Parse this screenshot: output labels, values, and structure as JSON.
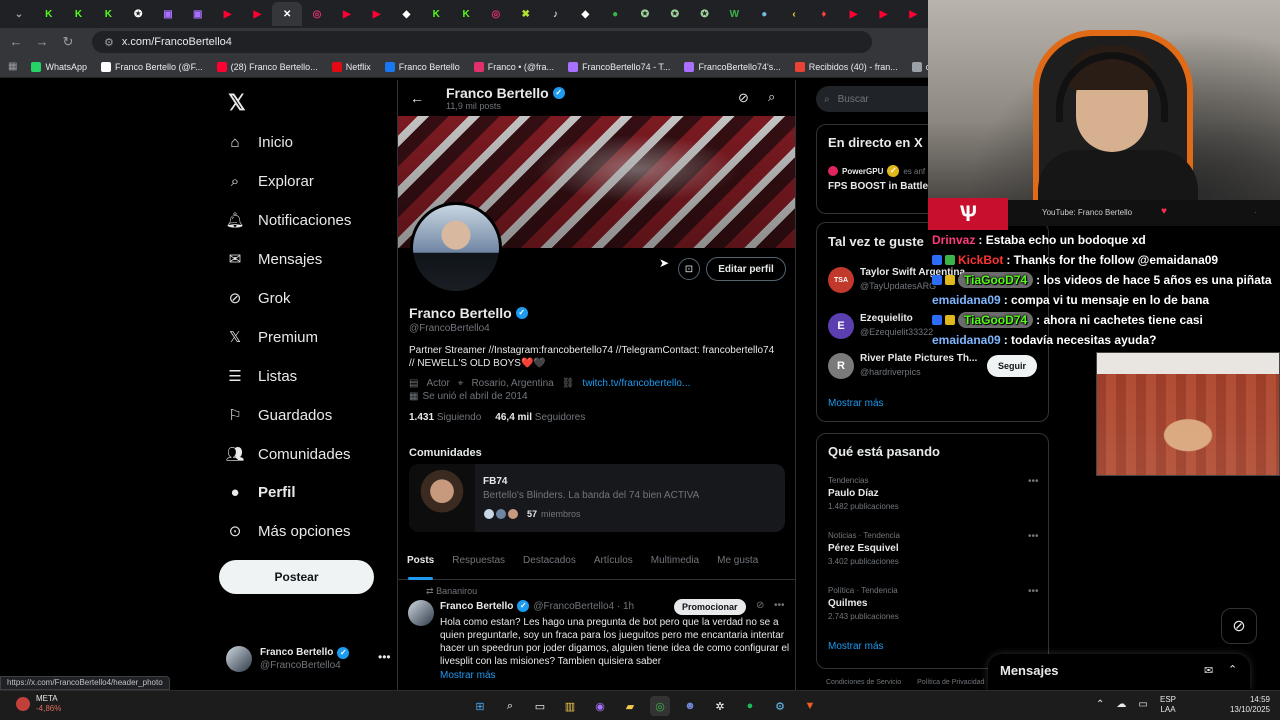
{
  "browser": {
    "url": "x.com/FrancoBertello4",
    "status_url": "https://x.com/FrancoBertello4/header_photo",
    "tabs": [
      {
        "glyph": "K",
        "color": "#53fc18"
      },
      {
        "glyph": "K",
        "color": "#53fc18"
      },
      {
        "glyph": "K",
        "color": "#53fc18"
      },
      {
        "glyph": "✪",
        "color": "#ffffff"
      },
      {
        "glyph": "▣",
        "color": "#a970ff"
      },
      {
        "glyph": "▣",
        "color": "#a970ff"
      },
      {
        "glyph": "▶",
        "color": "#ff0033"
      },
      {
        "glyph": "▶",
        "color": "#ff0033"
      },
      {
        "glyph": "✕",
        "color": "#ffffff",
        "active": true
      },
      {
        "glyph": "◎",
        "color": "#e1306c"
      },
      {
        "glyph": "▶",
        "color": "#ff0033"
      },
      {
        "glyph": "▶",
        "color": "#ff0033"
      },
      {
        "glyph": "◆",
        "color": "#ffffff"
      },
      {
        "glyph": "K",
        "color": "#53fc18"
      },
      {
        "glyph": "K",
        "color": "#53fc18"
      },
      {
        "glyph": "◎",
        "color": "#e1306c"
      },
      {
        "glyph": "✖",
        "color": "#b4e233"
      },
      {
        "glyph": "♪",
        "color": "#ffffff"
      },
      {
        "glyph": "◆",
        "color": "#ffffff"
      },
      {
        "glyph": "●",
        "color": "#3bb54a"
      },
      {
        "glyph": "✪",
        "color": "#9fd39c"
      },
      {
        "glyph": "✪",
        "color": "#9fd39c"
      },
      {
        "glyph": "✪",
        "color": "#9fd39c"
      },
      {
        "glyph": "W",
        "color": "#3bb54a"
      },
      {
        "glyph": "●",
        "color": "#74b9e0"
      },
      {
        "glyph": "‹",
        "color": "#f6d53a"
      },
      {
        "glyph": "♦",
        "color": "#ff3b3b"
      },
      {
        "glyph": "▶",
        "color": "#ff0033"
      },
      {
        "glyph": "▶",
        "color": "#ff0033"
      },
      {
        "glyph": "▶",
        "color": "#ff0033"
      }
    ],
    "bookmarks": [
      {
        "label": "WhatsApp",
        "color": "#25d366"
      },
      {
        "label": "Franco Bertello (@F...",
        "color": "#ffffff"
      },
      {
        "label": "(28) Franco Bertello...",
        "color": "#ff0033"
      },
      {
        "label": "Netflix",
        "color": "#e50914"
      },
      {
        "label": "Franco Bertello",
        "color": "#1877f2"
      },
      {
        "label": "Franco • (@fra...",
        "color": "#e1306c"
      },
      {
        "label": "FrancoBertello74 - T...",
        "color": "#a970ff"
      },
      {
        "label": "FrancoBertello74's...",
        "color": "#a970ff"
      },
      {
        "label": "Recibidos (40) - fran...",
        "color": "#ea4335"
      },
      {
        "label": "outlook",
        "color": "#9aa0a6"
      },
      {
        "label": "Aler",
        "color": "#3bb54a"
      }
    ]
  },
  "nav": {
    "items": [
      {
        "label": "Inicio",
        "icon": "home-icon"
      },
      {
        "label": "Explorar",
        "icon": "search-icon"
      },
      {
        "label": "Notificaciones",
        "icon": "bell-icon"
      },
      {
        "label": "Mensajes",
        "icon": "mail-icon"
      },
      {
        "label": "Grok",
        "icon": "grok-icon"
      },
      {
        "label": "Premium",
        "icon": "x-icon"
      },
      {
        "label": "Listas",
        "icon": "list-icon"
      },
      {
        "label": "Guardados",
        "icon": "bookmark-icon"
      },
      {
        "label": "Comunidades",
        "icon": "people-icon"
      },
      {
        "label": "Perfil",
        "icon": "person-icon"
      },
      {
        "label": "Más opciones",
        "icon": "more-circle-icon"
      }
    ],
    "post_button": "Postear",
    "account_name": "Franco Bertello",
    "account_handle": "@FrancoBertello4"
  },
  "profile": {
    "name": "Franco Bertello",
    "post_count": "11,9 mil posts",
    "handle": "@FrancoBertello4",
    "edit_button": "Editar perfil",
    "bio": "Partner Streamer //Instagram:francobertello74 //TelegramContact: francobertello74 // NEWELL'S OLD BOYS❤️🖤",
    "category": "Actor",
    "location": "Rosario, Argentina",
    "link": "twitch.tv/francobertello...",
    "joined": "Se unió el abril de 2014",
    "following_count": "1.431",
    "following_label": "Siguiendo",
    "followers_count": "46,4 mil",
    "followers_label": "Seguidores"
  },
  "community": {
    "title": "Comunidades",
    "name": "FB74",
    "description": "Bertello's Blinders. La banda del 74 bien ACTIVA",
    "members_count": "57",
    "members_label": "miembros"
  },
  "tabs": [
    "Posts",
    "Respuestas",
    "Destacados",
    "Artículos",
    "Multimedia",
    "Me gusta"
  ],
  "post": {
    "repost_label": "Bananirou",
    "author": "Franco Bertello",
    "handle_time": "@FrancoBertello4 · 1h",
    "promote_button": "Promocionar",
    "text": "Hola como estan? Les hago una pregunta de bot pero que la verdad no se a quien preguntarle, soy un fraca para los jueguitos pero me encantaria intentar hacer un speedrun por joder digamos, alguien tiene idea de como configurar el livesplit con las misiones? Tambien quisiera saber",
    "more_label": "Mostrar más"
  },
  "right": {
    "search_placeholder": "Buscar",
    "live_title": "En directo en X",
    "live_account": "PowerGPU",
    "live_suffix": "es anf",
    "live_stream_title": "FPS BOOST in Battle",
    "suggest_title": "Tal vez te guste",
    "suggestions": [
      {
        "name": "Taylor Swift Argentina",
        "handle": "@TayUpdatesARG",
        "initial": "TSA",
        "color": "#c0392b"
      },
      {
        "name": "Ezequielito",
        "handle": "@Ezequielit33322",
        "initial": "E",
        "color": "#5b3fb0"
      },
      {
        "name": "River Plate Pictures Th...",
        "handle": "@hardriverpics",
        "initial": "R",
        "color": "#7a7a7a"
      }
    ],
    "follow_button": "Seguir",
    "show_more": "Mostrar más",
    "trends_title": "Qué está pasando",
    "trends": [
      {
        "context": "Tendencias",
        "name": "Paulo Díaz",
        "posts": "1.482 publicaciones"
      },
      {
        "context": "Noticias · Tendencia",
        "name": "Pérez Esquivel",
        "posts": "3.402 publicaciones"
      },
      {
        "context": "Política · Tendencia",
        "name": "Quilmes",
        "posts": "2.743 publicaciones"
      }
    ],
    "footer": [
      "Condiciones de Servicio",
      "Política de Privacidad"
    ],
    "messages_title": "Mensajes"
  },
  "stream": {
    "chat_source": "YouTube: Franco Bertello",
    "chat": [
      {
        "user": "Drinvaz",
        "user_color": "#ff3a7a",
        "msg": ": Estaba echo un bodoque xd",
        "badges": []
      },
      {
        "user": "KickBot",
        "user_color": "#ff3333",
        "msg": ": Thanks for the follow @emaidana09",
        "badges": [
          "#2d6df6",
          "#3bb54a"
        ]
      },
      {
        "user": "TiaGooD74",
        "user_color": "#53fc18",
        "msg": ": los videos de hace 5 años es una piñata",
        "badges": [
          "#2d6df6",
          "#e2b719"
        ],
        "pill": true
      },
      {
        "user": "emaidana09",
        "user_color": "#7fb6ff",
        "msg": ": compa vi tu mensaje en lo de bana",
        "badges": []
      },
      {
        "user": "TiaGooD74",
        "user_color": "#53fc18",
        "msg": ": ahora ni cachetes tiene casi",
        "badges": [
          "#2d6df6",
          "#e2b719"
        ],
        "pill": true
      },
      {
        "user": "emaidana09",
        "user_color": "#7fb6ff",
        "msg": ": todavía necesitas ayuda?",
        "badges": []
      }
    ]
  },
  "taskbar": {
    "ticker": "META",
    "ticker_change": "-4,86%",
    "lang1": "ESP",
    "lang2": "LAA",
    "time": "14:59",
    "date": "13/10/2025"
  }
}
